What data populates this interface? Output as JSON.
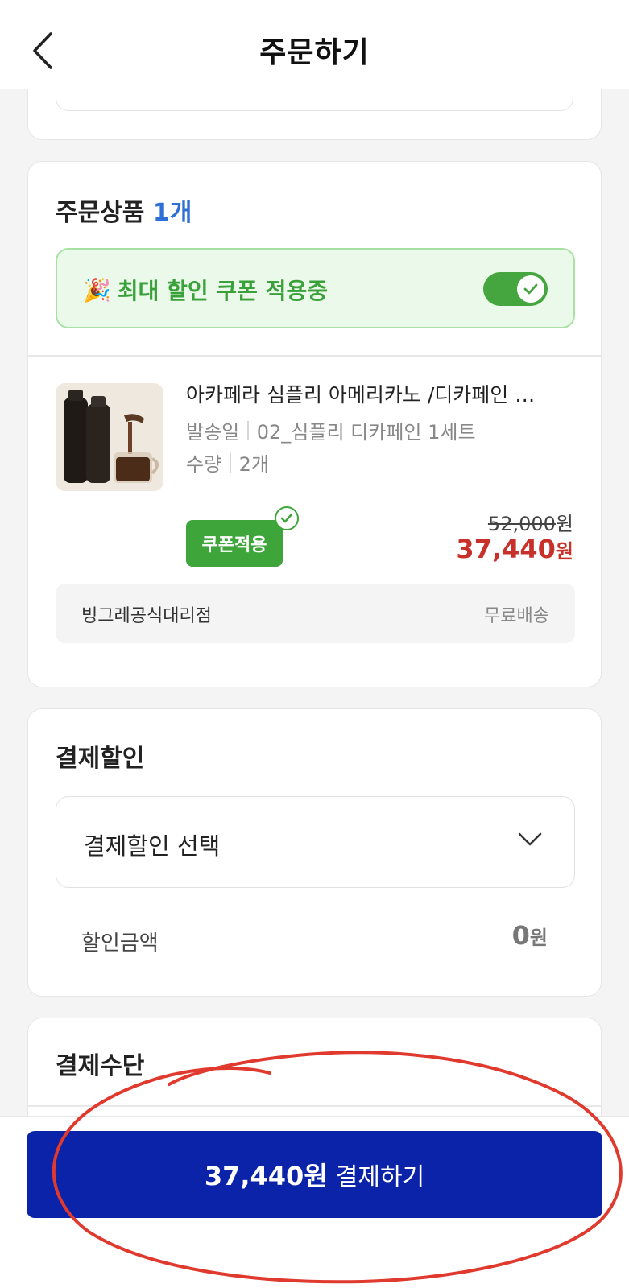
{
  "header": {
    "title": "주문하기"
  },
  "order_items": {
    "title": "주문상품",
    "count": "1개",
    "coupon_banner": {
      "emoji": "🎉",
      "text": "최대 할인 쿠폰 적용중",
      "toggle_on": true
    },
    "product": {
      "name": "아카페라 심플리 아메리카노 /디카페인 …",
      "ship_date_label": "발송일",
      "ship_date_value": "02_심플리 디카페인 1세트",
      "qty_label": "수량",
      "qty_value": "2개",
      "coupon_badge": "쿠폰적용",
      "original_price": "52,000",
      "original_won": "원",
      "final_price": "37,440",
      "final_won": "원"
    },
    "seller": {
      "name": "빙그레공식대리점",
      "shipping": "무료배송"
    }
  },
  "payment_discount": {
    "title": "결제할인",
    "select_placeholder": "결제할인 선택",
    "amount_label": "할인금액",
    "amount_value": "0",
    "amount_won": "원"
  },
  "payment_method": {
    "title": "결제수단"
  },
  "checkout": {
    "amount": "37,440원",
    "label": "결제하기"
  },
  "colors": {
    "primary": "#0a23a8",
    "coupon_green": "#3da53a",
    "price_red": "#c8302a",
    "count_blue": "#2e6fd6",
    "annotation_red": "#e03a2f"
  }
}
